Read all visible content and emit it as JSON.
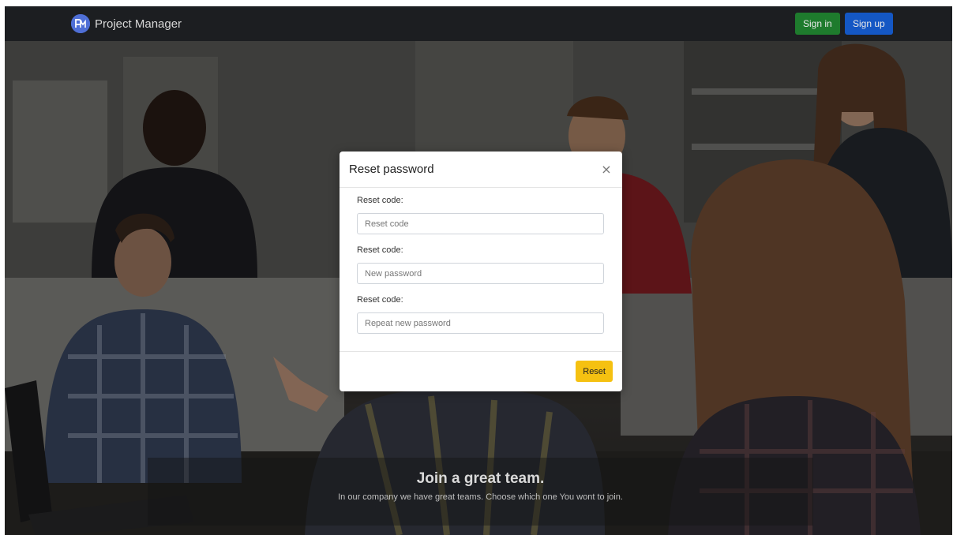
{
  "navbar": {
    "brand_name": "Project Manager",
    "signin_label": "Sign in",
    "signup_label": "Sign up"
  },
  "modal": {
    "title": "Reset password",
    "close_glyph": "×",
    "fields": [
      {
        "label": "Reset code:",
        "placeholder": "Reset code"
      },
      {
        "label": "Reset code:",
        "placeholder": "New password"
      },
      {
        "label": "Reset code:",
        "placeholder": "Repeat new password"
      }
    ],
    "reset_label": "Reset"
  },
  "caption": {
    "title": "Join a great team.",
    "text": "In our company we have great teams. Choose which one You wont to join."
  },
  "colors": {
    "navbar": "#1c1e21",
    "signin": "#1e7b2d",
    "signup": "#1457c4",
    "reset": "#f5c111"
  }
}
